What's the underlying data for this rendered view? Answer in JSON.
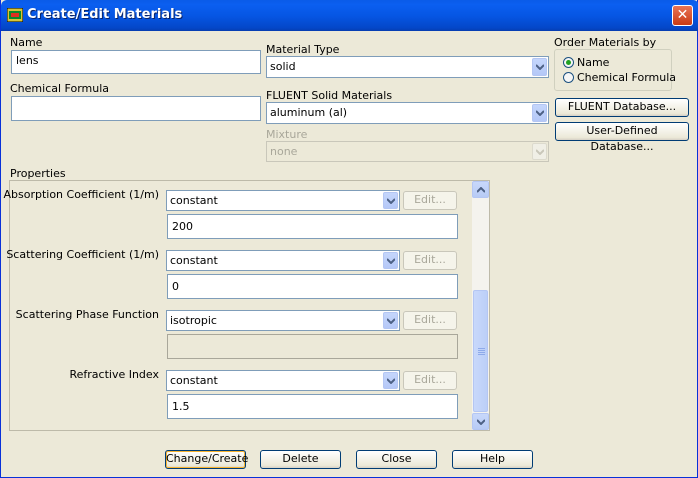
{
  "window": {
    "title": "Create/Edit Materials",
    "close_label": "✕"
  },
  "name": {
    "label": "Name",
    "value": "lens"
  },
  "chemical_formula": {
    "label": "Chemical Formula",
    "value": ""
  },
  "material_type": {
    "label": "Material Type",
    "value": "solid"
  },
  "solid_materials": {
    "label": "FLUENT Solid Materials",
    "value": "aluminum (al)"
  },
  "mixture": {
    "label": "Mixture",
    "value": "none"
  },
  "order_by": {
    "label": "Order Materials by",
    "options": [
      {
        "label": "Name",
        "selected": true
      },
      {
        "label": "Chemical Formula",
        "selected": false
      }
    ]
  },
  "database_buttons": {
    "fluent": "FLUENT Database...",
    "user_defined": "User-Defined Database..."
  },
  "properties": {
    "label": "Properties",
    "edit_label": "Edit...",
    "rows": [
      {
        "label": "Absorption Coefficient (1/m)",
        "method": "constant",
        "value": "200"
      },
      {
        "label": "Scattering Coefficient (1/m)",
        "method": "constant",
        "value": "0"
      },
      {
        "label": "Scattering Phase Function",
        "method": "isotropic",
        "value": ""
      },
      {
        "label": "Refractive Index",
        "method": "constant",
        "value": "1.5"
      }
    ]
  },
  "footer": {
    "change_create": "Change/Create",
    "delete": "Delete",
    "close": "Close",
    "help": "Help"
  },
  "colors": {
    "title_bar": "#0a5be8",
    "dialog_bg": "#ece9d8",
    "input_border": "#7f9db9",
    "radio_dot": "#21a121"
  }
}
